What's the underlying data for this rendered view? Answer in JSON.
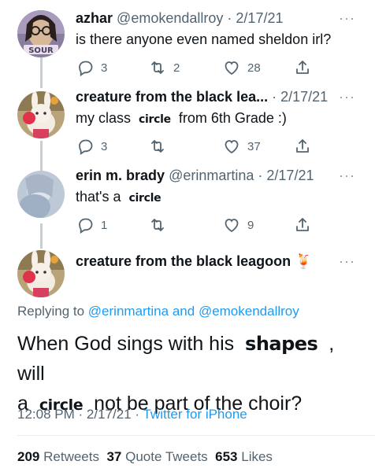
{
  "tweets": [
    {
      "name": "azhar",
      "handle": "@emokendallroy",
      "sep": "·",
      "date": "2/17/21",
      "text_before": "is there anyone even named sheldon irl?",
      "text_emph": "",
      "text_after": "",
      "avatar_badge": "SOUR",
      "replies": "3",
      "retweets": "2",
      "likes": "28"
    },
    {
      "name": "creature from the black lea...",
      "handle": "",
      "sep": "·",
      "date": "2/17/21",
      "text_before": "my class",
      "text_emph": "circle",
      "text_after": "from 6th Grade :)",
      "replies": "3",
      "retweets": "",
      "likes": "37"
    },
    {
      "name": "erin m. brady",
      "handle": "@erinmartina",
      "sep": "·",
      "date": "2/17/21",
      "text_before": "that's a",
      "text_emph": "circle",
      "text_after": "",
      "replies": "1",
      "retweets": "",
      "likes": "9"
    }
  ],
  "main_tweet": {
    "name": "creature from the black leagoon",
    "name_emoji": "🍹",
    "replying_prefix": "Replying to",
    "replying_user1": "@erinmartina",
    "replying_and": "and",
    "replying_user2": "@emokendallroy",
    "line1_before": "When God sings with his",
    "line1_emph": "shapes",
    "line1_after": ", will",
    "line2_before": "a",
    "line2_emph": "circle",
    "line2_after": "not be part of the choir?",
    "time": "12:08 PM",
    "date": "2/17/21",
    "source": "Twitter for iPhone",
    "retweets_count": "209",
    "retweets_label": "Retweets",
    "quotes_count": "37",
    "quotes_label": "Quote Tweets",
    "likes_count": "653",
    "likes_label": "Likes"
  },
  "more_glyph": "···",
  "colors": {
    "accent": "#1d9bf0",
    "muted": "#536471",
    "thread_line": "#c4cfd6"
  },
  "icons": [
    "reply-icon",
    "retweet-icon",
    "like-icon",
    "share-icon",
    "more-icon"
  ]
}
